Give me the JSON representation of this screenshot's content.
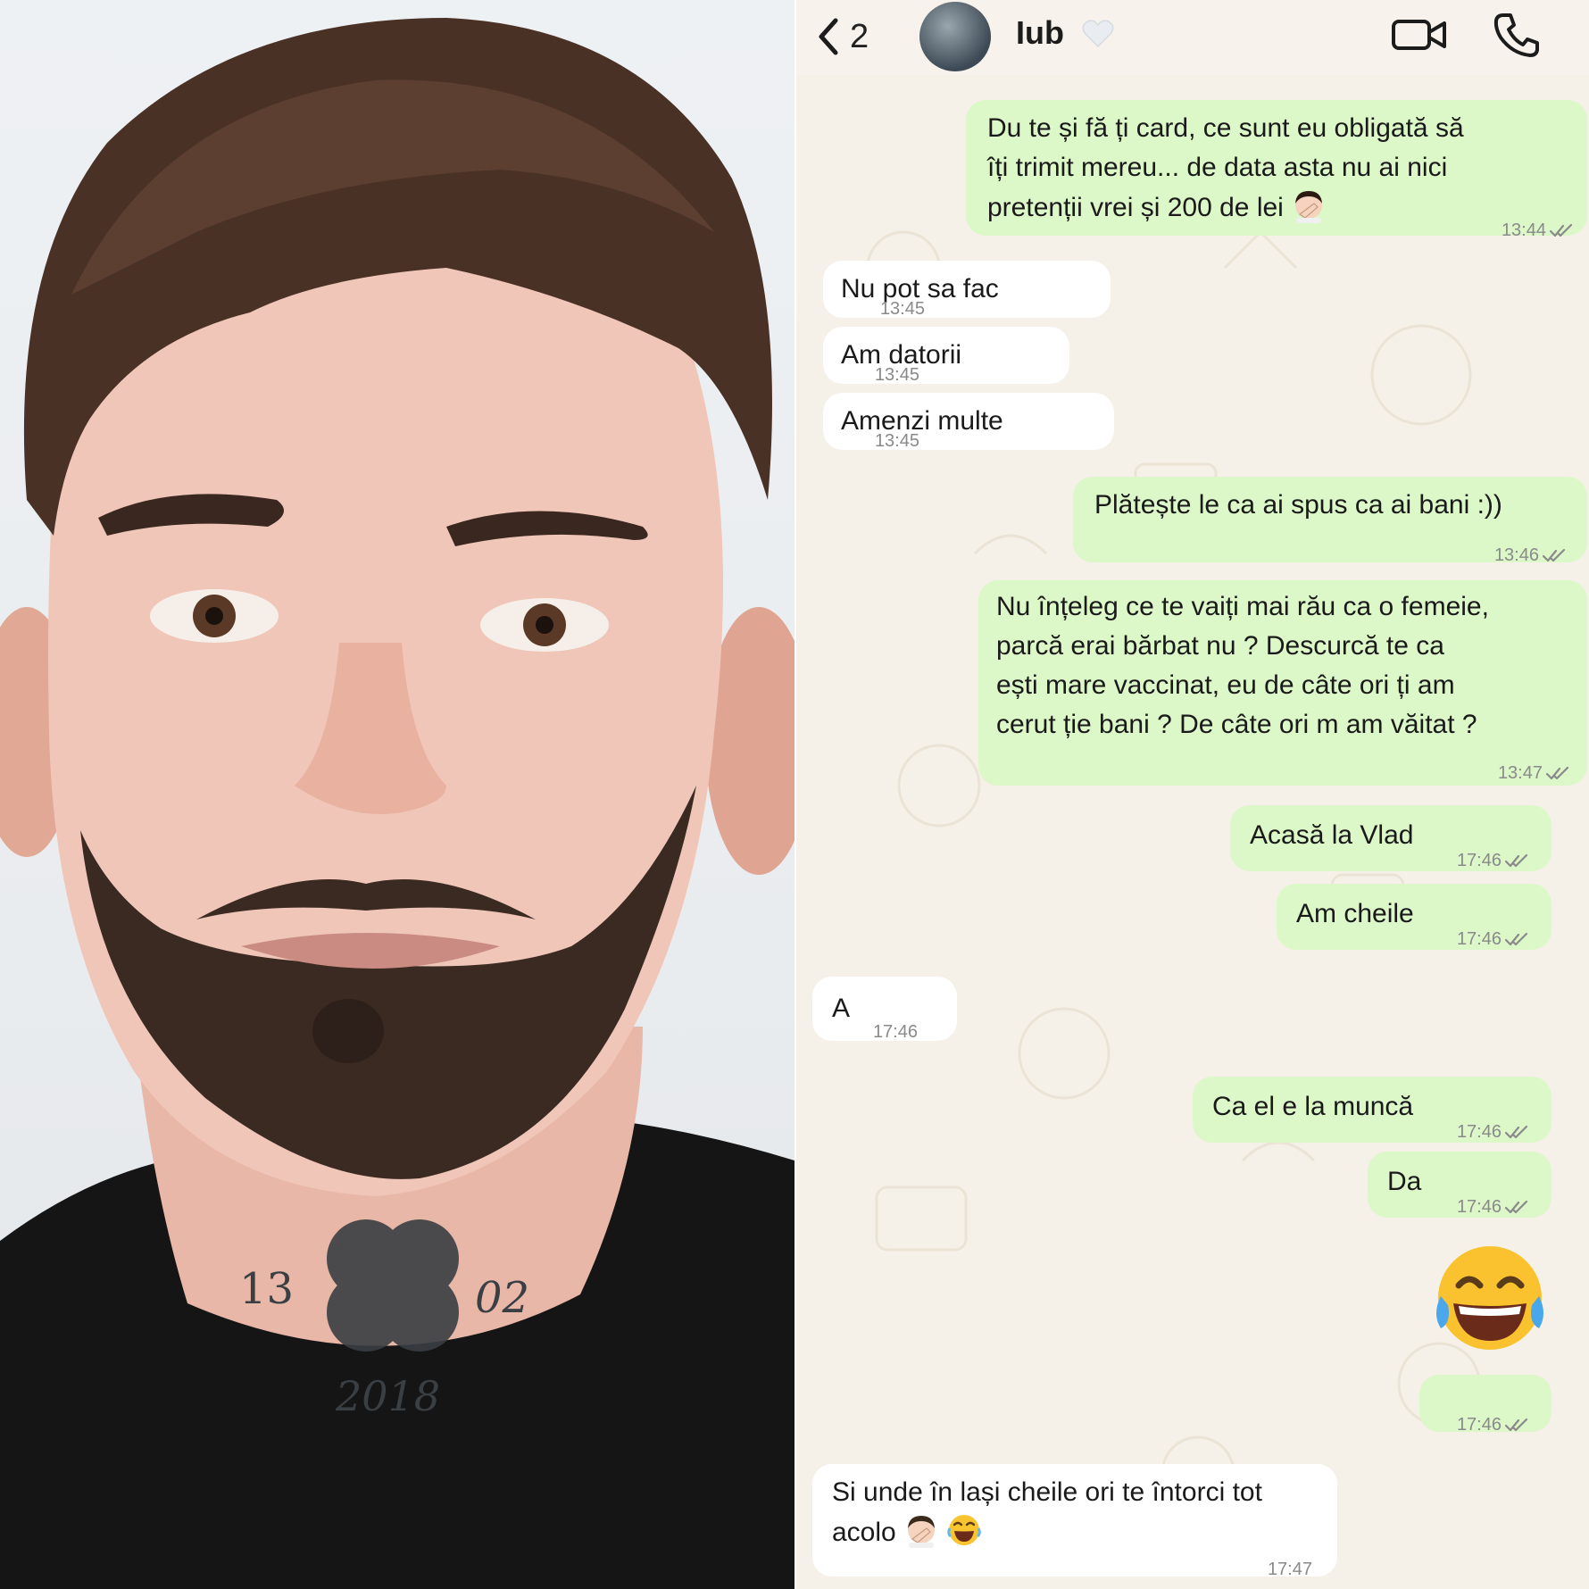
{
  "header": {
    "back_count": "2",
    "contact_name": "Iub",
    "icons": [
      "back-chevron-icon",
      "avatar",
      "heart-icon",
      "video-call-icon",
      "phone-call-icon"
    ]
  },
  "photo": {
    "neck_tattoo": "13 02 2018"
  },
  "messages": [
    {
      "dir": "out",
      "lines": [
        "Du te și fă ți card, ce sunt eu obligată să",
        "îți trimit mereu... de data asta nu ai nici",
        "pretenții vrei și 200 de lei"
      ],
      "emoji": "woman-facepalm",
      "time": "13:44"
    },
    {
      "dir": "in",
      "lines": [
        "Nu pot sa fac"
      ],
      "time": "13:45"
    },
    {
      "dir": "in",
      "lines": [
        "Am datorii"
      ],
      "time": "13:45"
    },
    {
      "dir": "in",
      "lines": [
        "Amenzi multe"
      ],
      "time": "13:45"
    },
    {
      "dir": "out",
      "lines": [
        "Plătește le ca ai spus ca ai bani :))"
      ],
      "time": "13:46"
    },
    {
      "dir": "out",
      "lines": [
        "Nu înțeleg ce te vaiți mai rău ca o femeie,",
        "parcă erai bărbat nu ? Descurcă te ca",
        "ești mare vaccinat, eu de câte ori ți am",
        "cerut ție bani ? De câte ori m am văitat ?"
      ],
      "time": "13:47"
    },
    {
      "dir": "out",
      "lines": [
        "Acasă la Vlad"
      ],
      "time": "17:46"
    },
    {
      "dir": "out",
      "lines": [
        "Am cheile"
      ],
      "time": "17:46"
    },
    {
      "dir": "in",
      "lines": [
        "A"
      ],
      "time": "17:46"
    },
    {
      "dir": "out",
      "lines": [
        "Ca el e la muncă"
      ],
      "time": "17:46"
    },
    {
      "dir": "out",
      "lines": [
        "Da"
      ],
      "time": "17:46"
    },
    {
      "dir": "out",
      "lines": [],
      "emoji": "face-with-tears-of-joy",
      "time": "17:46"
    },
    {
      "dir": "in",
      "lines": [
        "Si unde în lași cheile ori te întorci tot",
        "acolo"
      ],
      "emoji": "man-facepalm laughing",
      "time": "17:47"
    }
  ],
  "colors": {
    "outgoing_bubble": "#dcf7c8",
    "incoming_bubble": "#ffffff",
    "chat_background": "#f6f1e8",
    "read_ticks": "#8a8a8a"
  }
}
